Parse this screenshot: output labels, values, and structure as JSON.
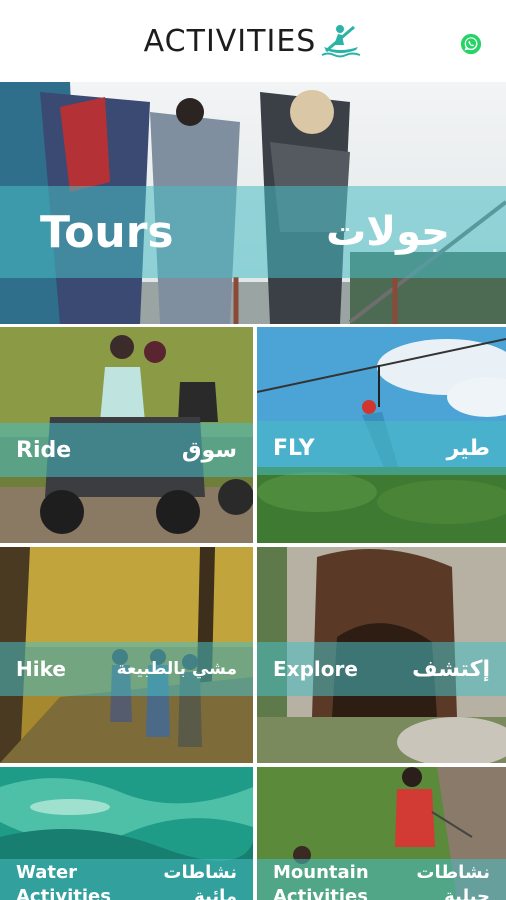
{
  "header": {
    "title": "ACTIVITIES",
    "logo_icon": "kayak-paddler-icon",
    "whatsapp_icon": "whatsapp-icon",
    "accent": "#2bb3a8"
  },
  "tiles": [
    {
      "id": "tours",
      "en": "Tours",
      "ar": "جولات"
    },
    {
      "id": "ride",
      "en": "Ride",
      "ar": "سوق"
    },
    {
      "id": "fly",
      "en": "FLY",
      "ar": "طير"
    },
    {
      "id": "hike",
      "en": "Hike",
      "ar": "مشي بالطبيعة"
    },
    {
      "id": "explore",
      "en": "Explore",
      "ar": "إكتشف"
    },
    {
      "id": "water",
      "en": "Water Activities",
      "ar": "نشاطات مائية"
    },
    {
      "id": "mountain",
      "en": "Mountain Activities",
      "ar": "نشاطات جبلية"
    }
  ]
}
